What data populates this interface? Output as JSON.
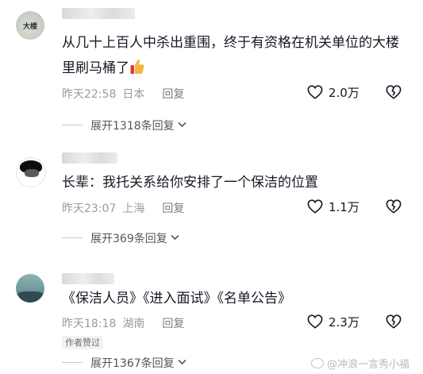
{
  "comments": [
    {
      "text": "从几十上百人中杀出重围，终于有资格在机关单位的大楼\n里刷马桶了",
      "time": "昨天22:58",
      "location": "日本",
      "reply_label": "回复",
      "likes": "2.0万",
      "expand_label": "展开1318条回复",
      "avatar_text": "大楼",
      "emoji": "thumbs-up-icon"
    },
    {
      "text": "长辈：我托关系给你安排了一个保洁的位置",
      "time": "昨天23:07",
      "location": "上海",
      "reply_label": "回复",
      "likes": "1.1万",
      "expand_label": "展开369条回复"
    },
    {
      "text": "《保洁人员》《进入面试》《名单公告》",
      "time": "昨天18:18",
      "location": "湖南",
      "reply_label": "回复",
      "likes": "2.3万",
      "badge": "作者赞过",
      "expand_label": "展开1367条回复"
    }
  ],
  "watermark": "@冲浪一言秀小福",
  "colors": {
    "text": "#161823",
    "meta": "#9a9ba0",
    "emoji": "#f5b53f"
  }
}
